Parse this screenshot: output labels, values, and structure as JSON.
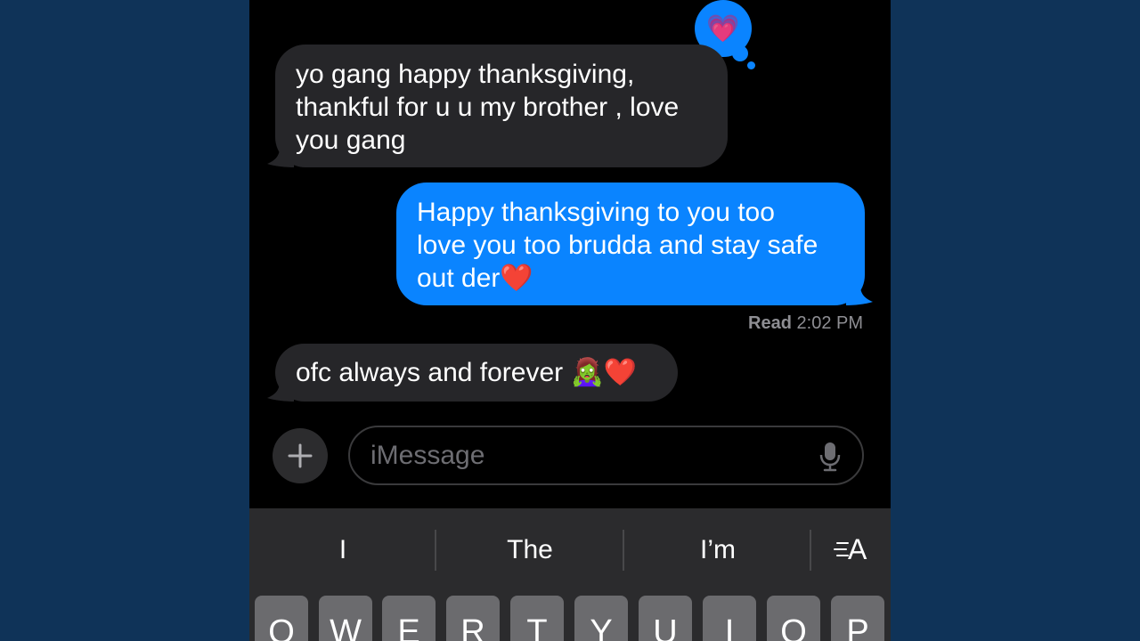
{
  "conversation": {
    "messages": [
      {
        "direction": "incoming",
        "text": "yo gang happy thanksgiving,\nthankful for u u my brother , love\nyou gang"
      },
      {
        "direction": "outgoing",
        "text": "Happy thanksgiving to you too\nlove you too brudda and stay safe\nout der❤️"
      },
      {
        "direction": "incoming",
        "text": "ofc always and forever 🧟‍♀️❤️"
      }
    ],
    "tapback": {
      "emoji": "💗",
      "icon": "pink-heart-icon"
    },
    "read_receipt": {
      "label": "Read",
      "time": "2:02 PM"
    }
  },
  "composer": {
    "placeholder": "iMessage",
    "add_icon": "plus-icon",
    "mic_icon": "microphone-icon"
  },
  "keyboard": {
    "suggestions": [
      "I",
      "The",
      "I’m"
    ],
    "format_icon": "text-format-icon",
    "format_label": "A",
    "top_row": [
      "Q",
      "W",
      "E",
      "R",
      "T",
      "Y",
      "U",
      "I",
      "O",
      "P"
    ]
  },
  "colors": {
    "outgoing_bubble": "#0a84ff",
    "incoming_bubble": "#262629",
    "background": "#000000",
    "outer_background": "#0f3358"
  }
}
